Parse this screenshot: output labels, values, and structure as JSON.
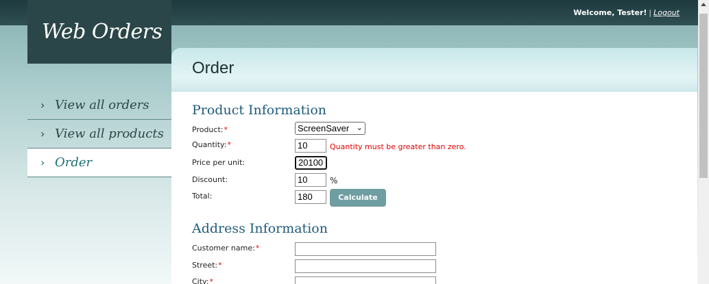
{
  "header": {
    "welcome": "Welcome, Tester!",
    "separator": "|",
    "logout": "Logout"
  },
  "logo": {
    "text": "Web Orders"
  },
  "nav": {
    "items": [
      {
        "label": "View all orders"
      },
      {
        "label": "View all products"
      },
      {
        "label": "Order",
        "active": true
      }
    ],
    "chevron": "›"
  },
  "page": {
    "title": "Order"
  },
  "product_section": {
    "title": "Product Information",
    "product_label": "Product:",
    "product_value": "ScreenSaver",
    "quantity_label": "Quantity:",
    "quantity_value": "10",
    "quantity_error": "Quantity must be greater than zero.",
    "price_label": "Price per unit:",
    "price_value": "20100",
    "discount_label": "Discount:",
    "discount_value": "10",
    "discount_unit": "%",
    "total_label": "Total:",
    "total_value": "180",
    "calculate_label": "Calculate"
  },
  "address_section": {
    "title": "Address Information",
    "customer_label": "Customer name:",
    "customer_value": "",
    "street_label": "Street:",
    "street_value": "",
    "city_label": "City:",
    "city_value": ""
  },
  "required_mark": "*",
  "colors": {
    "topbar": "#2f4f53",
    "logo_bg": "#2b4649",
    "section_title": "#1f5a7a",
    "error": "#dd0000",
    "button": "#6e9ea1"
  },
  "icons": {
    "dropdown": "chevron-down-icon"
  }
}
